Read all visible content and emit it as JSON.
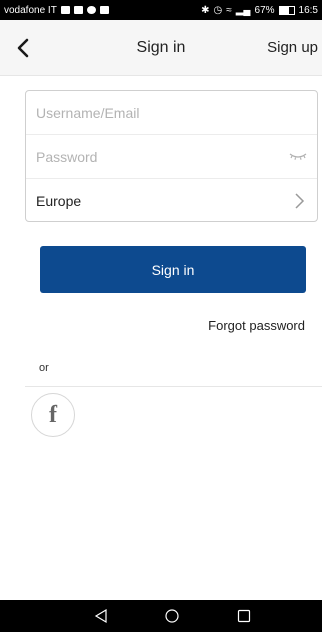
{
  "status_bar": {
    "carrier": "vodafone IT",
    "battery": "67%",
    "time": "16:5",
    "icons": [
      "image-icon",
      "mail-icon",
      "settings-icon",
      "facebook-icon",
      "bluetooth-icon",
      "alarm-icon",
      "wifi-icon",
      "signal-icon",
      "battery-icon"
    ]
  },
  "header": {
    "title": "Sign in",
    "sign_up_label": "Sign up",
    "back_icon": "chevron-left-icon"
  },
  "form": {
    "username": {
      "placeholder": "Username/Email",
      "value": ""
    },
    "password": {
      "placeholder": "Password",
      "value": "",
      "icon": "eye-closed-icon"
    },
    "region": {
      "value": "Europe",
      "icon": "chevron-right-icon"
    }
  },
  "actions": {
    "sign_in_label": "Sign in",
    "forgot_password_label": "Forgot password",
    "or_label": "or",
    "social_icon": "facebook-icon"
  },
  "colors": {
    "primary": "#0d4a8f",
    "header_bg": "#f6f6f6",
    "status_bar_bg": "#000000"
  },
  "nav_bar": {
    "icons": [
      "back-triangle-icon",
      "home-circle-icon",
      "recent-square-icon"
    ]
  }
}
